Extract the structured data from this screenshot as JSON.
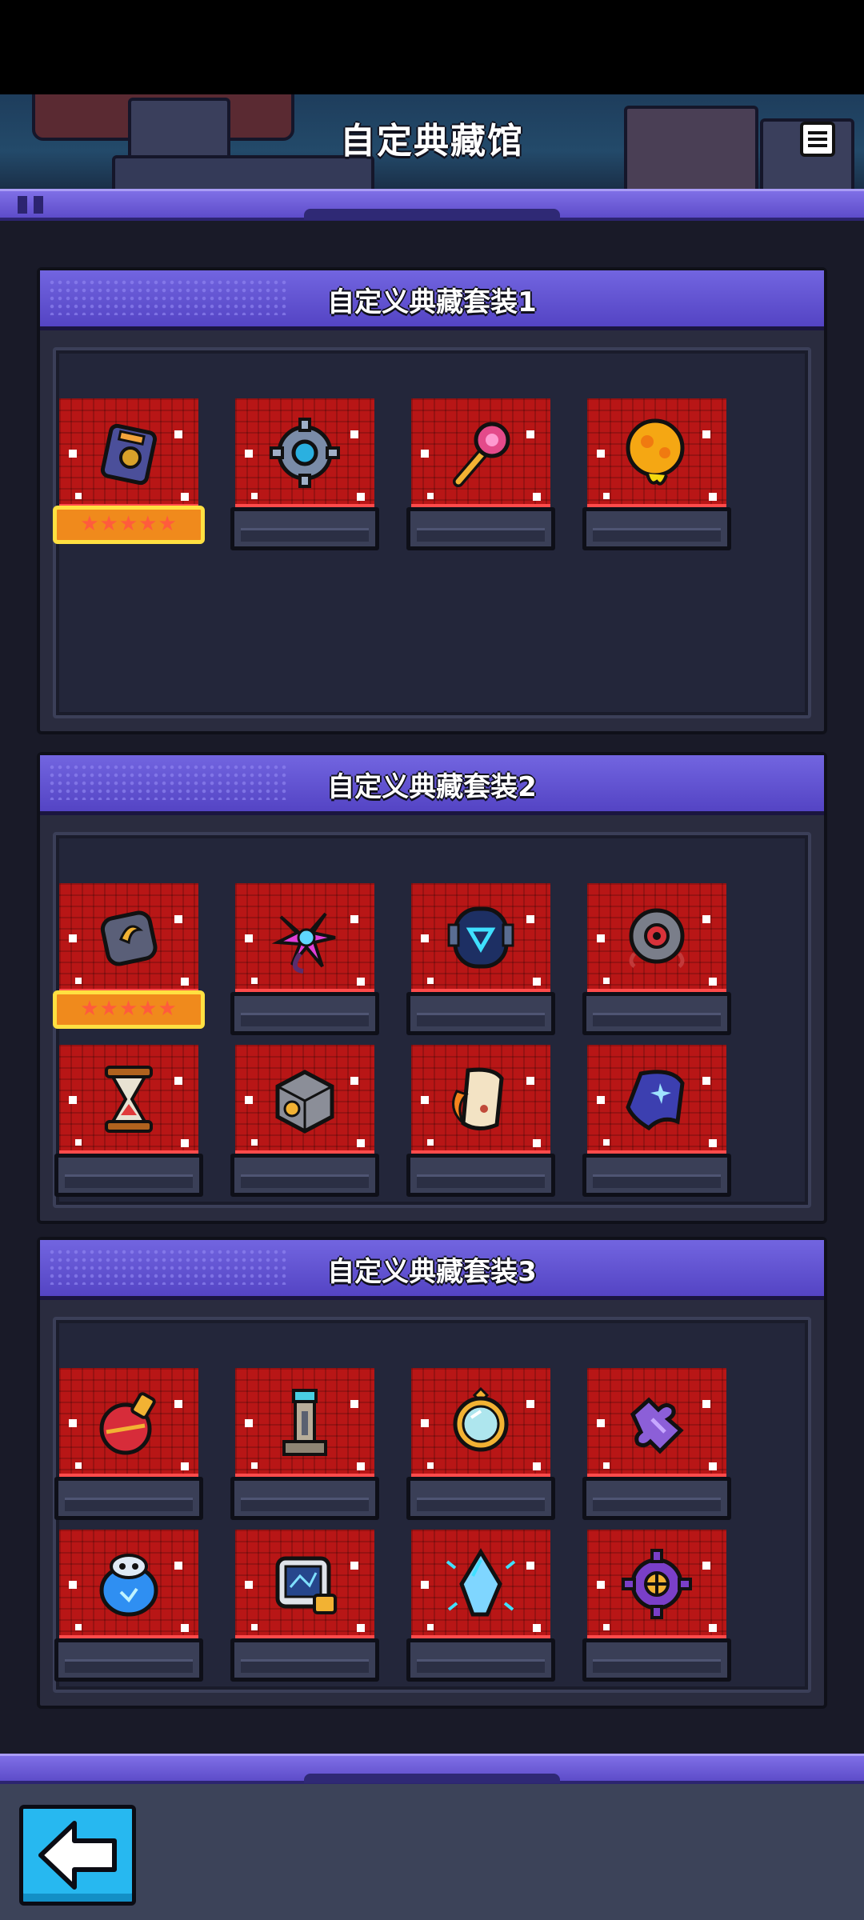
{
  "header": {
    "title": "自定典藏馆",
    "menu_icon": "list-menu-icon"
  },
  "sets": [
    {
      "title": "自定义典藏套装1",
      "items": [
        {
          "icon": "device-box-icon",
          "stars": "★★★★★"
        },
        {
          "icon": "gear-icon"
        },
        {
          "icon": "ruby-wand-icon"
        },
        {
          "icon": "slime-orb-icon"
        }
      ]
    },
    {
      "title": "自定义典藏套装2",
      "items": [
        {
          "icon": "horn-stone-icon",
          "stars": "★★★★★"
        },
        {
          "icon": "magic-flower-icon"
        },
        {
          "icon": "robot-helmet-icon"
        },
        {
          "icon": "red-eye-orb-icon"
        },
        {
          "icon": "hourglass-icon"
        },
        {
          "icon": "lock-dice-icon"
        },
        {
          "icon": "flame-scroll-icon"
        },
        {
          "icon": "star-cloak-icon"
        }
      ]
    },
    {
      "title": "自定义典藏套装3",
      "items": [
        {
          "icon": "red-potion-icon"
        },
        {
          "icon": "pillar-tower-icon"
        },
        {
          "icon": "mirror-icon"
        },
        {
          "icon": "purple-puzzle-icon"
        },
        {
          "icon": "ice-robot-icon"
        },
        {
          "icon": "circuit-screen-icon"
        },
        {
          "icon": "ice-crystal-icon"
        },
        {
          "icon": "purple-gear-icon"
        }
      ]
    }
  ],
  "footer": {
    "back_icon": "back-arrow-icon"
  }
}
